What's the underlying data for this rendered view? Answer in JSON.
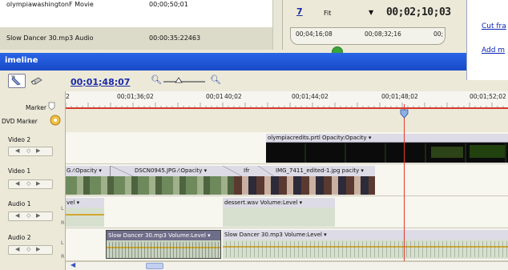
{
  "project": {
    "rows": [
      {
        "name": "olympiawashingtonF Movie",
        "duration": "00;00;50;01"
      },
      {
        "name": "Slow Dancer 30.mp3 Audio",
        "duration": "00:00:35:22463"
      }
    ]
  },
  "monitor": {
    "zoom": "Fit",
    "timecode": "00;02;10;03",
    "ruler": [
      "00;04;16;08",
      "00;08;32;16",
      "00;"
    ]
  },
  "tasks": {
    "links": [
      "Cut fra",
      "Add m"
    ]
  },
  "timeline": {
    "title": "imeline",
    "current_time": "00;01;48;07",
    "ruler_labels": [
      "2",
      "00;01;36;02",
      "00;01",
      "40;02",
      "00;01;44;02",
      "00;01;48;02",
      "00;01;52;02"
    ],
    "headers": {
      "marker": "Marker",
      "dvd_marker": "DVD Marker",
      "video2": "Video 2",
      "video1": "Video 1",
      "audio1": "Audio 1",
      "audio2": "Audio 2"
    },
    "clips": {
      "v2_olympia": "olympiacredits.prtl Opacity:Opacity ▾",
      "v1_a": "G ⁄:Opacity ▾",
      "v1_b": "DSCN0945.JPG ⁄:Opacity ▾",
      "v1_c": "Ifr",
      "v1_d": "IMG_7411_edited-1.jpg pacity ▾",
      "a1_a": "vel ▾",
      "a1_b": "dessert.wav Volume:Level ▾",
      "a2_a": "Slow Dancer 30.mp3 Volume:Level ▾",
      "a2_b": "Slow Dancer 30.mp3 Volume:Level ▾"
    }
  },
  "colors": {
    "title_bar": "#1f54d8",
    "playhead": "#e23a2a",
    "audio_clip": "#d7e0cf",
    "video_clip_header": "#dcdbe6"
  },
  "icons": [
    "selection-tool-icon",
    "razor-tool-icon",
    "zoom-out-icon",
    "zoom-in-icon",
    "marker-icon",
    "dvd-marker-icon",
    "playhead-icon",
    "play-icon"
  ]
}
